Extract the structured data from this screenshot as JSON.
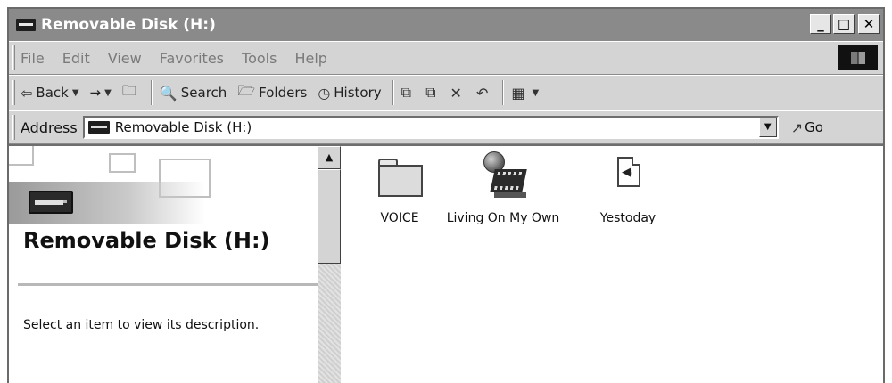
{
  "window": {
    "title": "Removable Disk (H:)"
  },
  "window_controls": {
    "minimize": "_",
    "maximize": "□",
    "close": "✕"
  },
  "menu": {
    "items": [
      "File",
      "Edit",
      "View",
      "Favorites",
      "Tools",
      "Help"
    ]
  },
  "toolbar": {
    "back": "Back",
    "forward": "→",
    "search": "Search",
    "folders": "Folders",
    "history": "History"
  },
  "address": {
    "label": "Address",
    "value": "Removable Disk (H:)",
    "go": "Go"
  },
  "left_pane": {
    "title": "Removable Disk (H:)",
    "description": "Select an item to view its description."
  },
  "files": [
    {
      "name": "VOICE",
      "icon": "folder-icon"
    },
    {
      "name": "Living On My Own",
      "icon": "media-file-icon"
    },
    {
      "name": "Yestoday",
      "icon": "sound-file-icon"
    }
  ],
  "colors": {
    "title_bar": "#8a8a8a",
    "chrome": "#d4d4d4",
    "content": "#ffffff"
  }
}
